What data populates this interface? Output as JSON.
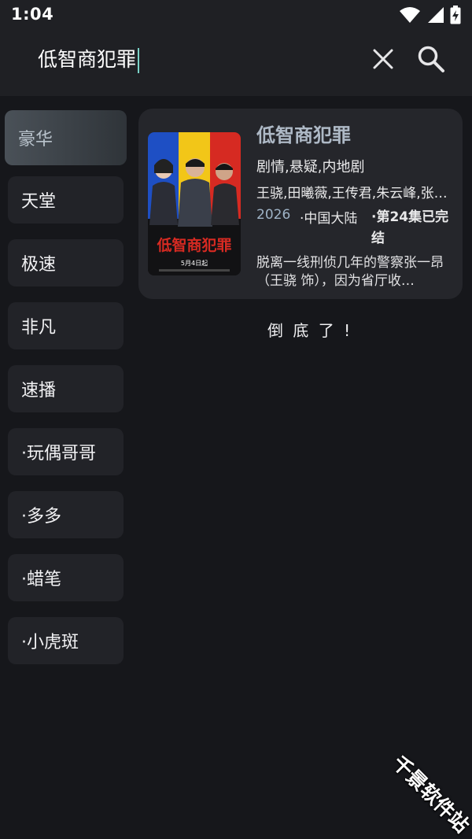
{
  "status_bar": {
    "time": "1:04"
  },
  "search": {
    "query": "低智商犯罪"
  },
  "sidebar": {
    "items": [
      {
        "label": "豪华",
        "active": true
      },
      {
        "label": "天堂"
      },
      {
        "label": "极速"
      },
      {
        "label": "非凡"
      },
      {
        "label": "速播"
      },
      {
        "label": "·玩偶哥哥"
      },
      {
        "label": "·多多"
      },
      {
        "label": "·蜡笔"
      },
      {
        "label": "·小虎斑"
      }
    ]
  },
  "result": {
    "title": "低智商犯罪",
    "genre": "剧情,悬疑,内地剧",
    "cast": "王骁,田曦薇,王传君,朱云峰,张…",
    "year": "2026",
    "region": "·中国大陆",
    "status": "·第24集已完结",
    "description": "脱离一线刑侦几年的警察张一昂（王骁 饰），因为省厅收…",
    "poster": {
      "title_text": "低智商犯罪",
      "date_text": "5月4日起",
      "stripe_colors": [
        "#1e4fc4",
        "#f2c618",
        "#d62a22"
      ]
    }
  },
  "list_end_text": "倒 底 了 !",
  "watermark": "千景软件站"
}
